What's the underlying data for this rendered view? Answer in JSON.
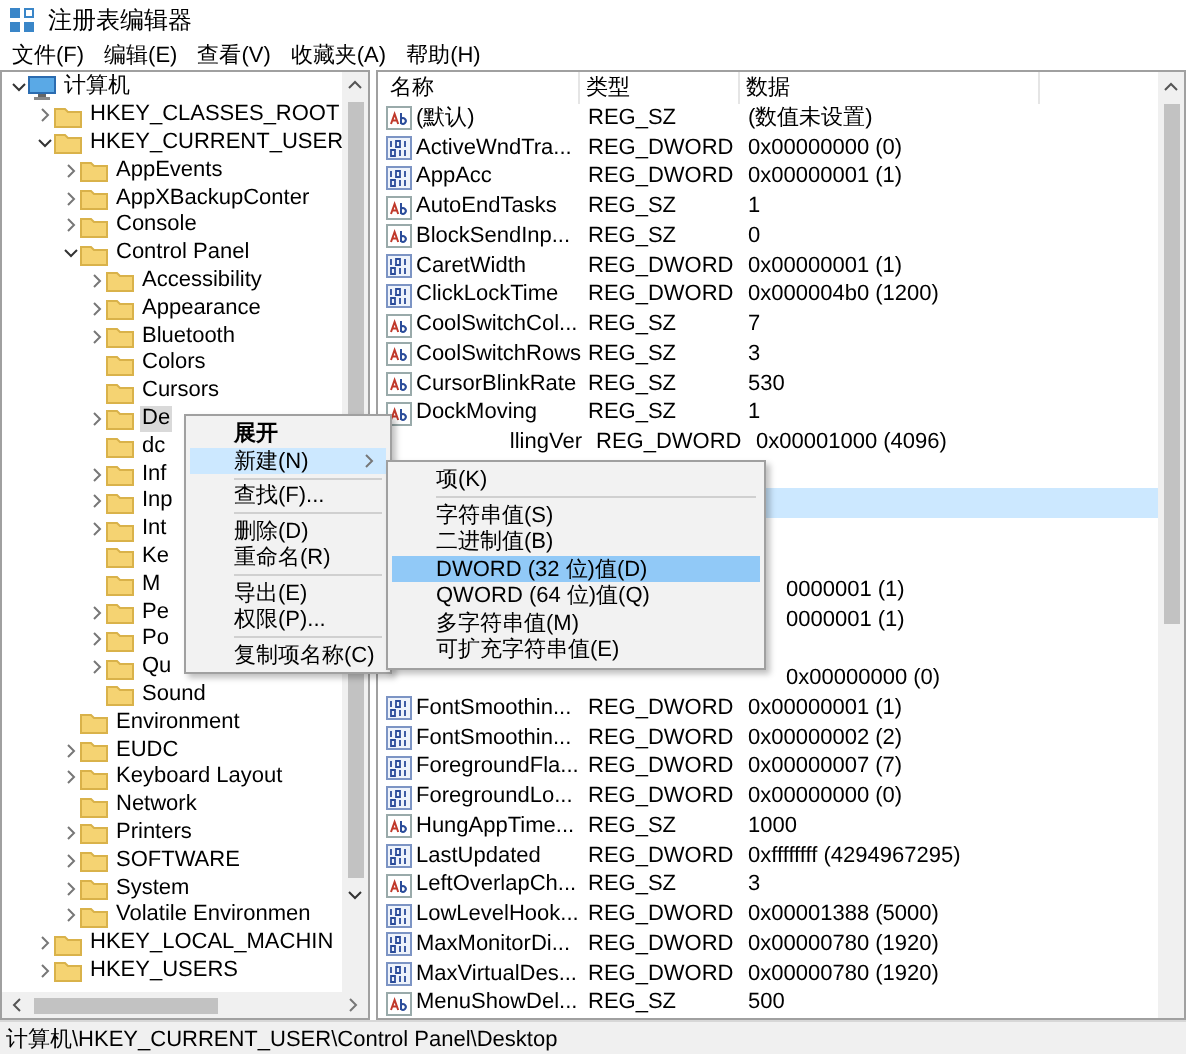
{
  "window": {
    "title": "注册表编辑器"
  },
  "menu_bar": [
    "文件(F)",
    "编辑(E)",
    "查看(V)",
    "收藏夹(A)",
    "帮助(H)"
  ],
  "tree": [
    {
      "label": "计算机",
      "kind": "computer",
      "expanded": true,
      "selected": false,
      "children": [
        {
          "label": "HKEY_CLASSES_ROOT",
          "kind": "folder",
          "expanded": false,
          "selected": false
        },
        {
          "label": "HKEY_CURRENT_USER",
          "kind": "folder",
          "expanded": true,
          "selected": false,
          "children": [
            {
              "label": "AppEvents",
              "kind": "folder",
              "expanded": false,
              "selected": false
            },
            {
              "label": "AppXBackupConter",
              "kind": "folder",
              "expanded": false,
              "selected": false
            },
            {
              "label": "Console",
              "kind": "folder",
              "expanded": false,
              "selected": false
            },
            {
              "label": "Control Panel",
              "kind": "folder",
              "expanded": true,
              "selected": false,
              "children": [
                {
                  "label": "Accessibility",
                  "kind": "folder",
                  "expanded": false,
                  "selected": false
                },
                {
                  "label": "Appearance",
                  "kind": "folder",
                  "expanded": false,
                  "selected": false
                },
                {
                  "label": "Bluetooth",
                  "kind": "folder",
                  "expanded": false,
                  "selected": false
                },
                {
                  "label": "Colors",
                  "kind": "folder",
                  "selected": false
                },
                {
                  "label": "Cursors",
                  "kind": "folder",
                  "selected": false
                },
                {
                  "label": "De",
                  "kind": "folder",
                  "expanded": false,
                  "selected": true
                },
                {
                  "label": "dc",
                  "kind": "folder",
                  "selected": false
                },
                {
                  "label": "Inf",
                  "kind": "folder",
                  "expanded": false,
                  "selected": false
                },
                {
                  "label": "Inp",
                  "kind": "folder",
                  "expanded": false,
                  "selected": false
                },
                {
                  "label": "Int",
                  "kind": "folder",
                  "expanded": false,
                  "selected": false
                },
                {
                  "label": "Ke",
                  "kind": "folder",
                  "selected": false
                },
                {
                  "label": "M",
                  "kind": "folder",
                  "selected": false
                },
                {
                  "label": "Pe",
                  "kind": "folder",
                  "expanded": false,
                  "selected": false
                },
                {
                  "label": "Po",
                  "kind": "folder",
                  "expanded": false,
                  "selected": false
                },
                {
                  "label": "Qu",
                  "kind": "folder",
                  "expanded": false,
                  "selected": false
                },
                {
                  "label": "Sound",
                  "kind": "folder",
                  "selected": false
                }
              ]
            },
            {
              "label": "Environment",
              "kind": "folder",
              "selected": false
            },
            {
              "label": "EUDC",
              "kind": "folder",
              "expanded": false,
              "selected": false
            },
            {
              "label": "Keyboard Layout",
              "kind": "folder",
              "expanded": false,
              "selected": false
            },
            {
              "label": "Network",
              "kind": "folder",
              "selected": false
            },
            {
              "label": "Printers",
              "kind": "folder",
              "expanded": false,
              "selected": false
            },
            {
              "label": "SOFTWARE",
              "kind": "folder",
              "expanded": false,
              "selected": false
            },
            {
              "label": "System",
              "kind": "folder",
              "expanded": false,
              "selected": false
            },
            {
              "label": "Volatile Environmen",
              "kind": "folder",
              "expanded": false,
              "selected": false
            }
          ]
        },
        {
          "label": "HKEY_LOCAL_MACHIN",
          "kind": "folder",
          "expanded": false,
          "selected": false
        },
        {
          "label": "HKEY_USERS",
          "kind": "folder",
          "expanded": false,
          "selected": false
        }
      ]
    }
  ],
  "list": {
    "columns": [
      "名称",
      "类型",
      "数据"
    ],
    "rows": [
      {
        "kind": "string",
        "name": "(默认)",
        "type": "REG_SZ",
        "data": "(数值未设置)",
        "selected": false
      },
      {
        "kind": "dword",
        "name": "ActiveWndTra...",
        "type": "REG_DWORD",
        "data": "0x00000000 (0)",
        "selected": false
      },
      {
        "kind": "dword",
        "name": "AppAcc",
        "type": "REG_DWORD",
        "data": "0x00000001 (1)",
        "selected": false
      },
      {
        "kind": "string",
        "name": "AutoEndTasks",
        "type": "REG_SZ",
        "data": "1",
        "selected": false
      },
      {
        "kind": "string",
        "name": "BlockSendInp...",
        "type": "REG_SZ",
        "data": "0",
        "selected": false
      },
      {
        "kind": "dword",
        "name": "CaretWidth",
        "type": "REG_DWORD",
        "data": "0x00000001 (1)",
        "selected": false
      },
      {
        "kind": "dword",
        "name": "ClickLockTime",
        "type": "REG_DWORD",
        "data": "0x000004b0 (1200)",
        "selected": false
      },
      {
        "kind": "string",
        "name": "CoolSwitchCol...",
        "type": "REG_SZ",
        "data": "7",
        "selected": false
      },
      {
        "kind": "string",
        "name": "CoolSwitchRows",
        "type": "REG_SZ",
        "data": "3",
        "selected": false
      },
      {
        "kind": "string",
        "name": "CursorBlinkRate",
        "type": "REG_SZ",
        "data": "530",
        "selected": false
      },
      {
        "kind": "string",
        "name": "DockMoving",
        "type": "REG_SZ",
        "data": "1",
        "selected": false
      },
      {
        "kind": "covered",
        "name": "llingVer",
        "type": "REG_DWORD",
        "data": "0x00001000 (4096)",
        "selected": false
      },
      {
        "kind": "covered",
        "selected": false
      },
      {
        "kind": "covered",
        "selected": true
      },
      {
        "kind": "covered",
        "selected": false
      },
      {
        "kind": "covered",
        "selected": false
      },
      {
        "kind": "covered",
        "data": "0000001 (1)",
        "selected": false
      },
      {
        "kind": "covered",
        "data": "0000001 (1)",
        "selected": false
      },
      {
        "kind": "covered",
        "selected": false
      },
      {
        "kind": "covered",
        "data": "0x00000000 (0)",
        "selected": false
      },
      {
        "kind": "dword",
        "name": "FontSmoothin...",
        "type": "REG_DWORD",
        "data": "0x00000001 (1)",
        "selected": false
      },
      {
        "kind": "dword",
        "name": "FontSmoothin...",
        "type": "REG_DWORD",
        "data": "0x00000002 (2)",
        "selected": false
      },
      {
        "kind": "dword",
        "name": "ForegroundFla...",
        "type": "REG_DWORD",
        "data": "0x00000007 (7)",
        "selected": false
      },
      {
        "kind": "dword",
        "name": "ForegroundLo...",
        "type": "REG_DWORD",
        "data": "0x00000000 (0)",
        "selected": false
      },
      {
        "kind": "string",
        "name": "HungAppTime...",
        "type": "REG_SZ",
        "data": "1000",
        "selected": false
      },
      {
        "kind": "dword",
        "name": "LastUpdated",
        "type": "REG_DWORD",
        "data": "0xffffffff (4294967295)",
        "selected": false
      },
      {
        "kind": "string",
        "name": "LeftOverlapCh...",
        "type": "REG_SZ",
        "data": "3",
        "selected": false
      },
      {
        "kind": "dword",
        "name": "LowLevelHook...",
        "type": "REG_DWORD",
        "data": "0x00001388 (5000)",
        "selected": false
      },
      {
        "kind": "dword",
        "name": "MaxMonitorDi...",
        "type": "REG_DWORD",
        "data": "0x00000780 (1920)",
        "selected": false
      },
      {
        "kind": "dword",
        "name": "MaxVirtualDes...",
        "type": "REG_DWORD",
        "data": "0x00000780 (1920)",
        "selected": false
      },
      {
        "kind": "string",
        "name": "MenuShowDel...",
        "type": "REG_SZ",
        "data": "500",
        "selected": false
      }
    ]
  },
  "context_menu": {
    "items": [
      {
        "kind": "item",
        "label": "展开",
        "default": true,
        "submenu": false,
        "selected": false
      },
      {
        "kind": "item",
        "label": "新建(N)",
        "default": false,
        "submenu": true,
        "selected": true
      },
      {
        "kind": "separator"
      },
      {
        "kind": "item",
        "label": "查找(F)...",
        "default": false,
        "submenu": false,
        "selected": false
      },
      {
        "kind": "separator"
      },
      {
        "kind": "item",
        "label": "删除(D)",
        "default": false,
        "submenu": false,
        "selected": false
      },
      {
        "kind": "item",
        "label": "重命名(R)",
        "default": false,
        "submenu": false,
        "selected": false
      },
      {
        "kind": "separator"
      },
      {
        "kind": "item",
        "label": "导出(E)",
        "default": false,
        "submenu": false,
        "selected": false
      },
      {
        "kind": "item",
        "label": "权限(P)...",
        "default": false,
        "submenu": false,
        "selected": false
      },
      {
        "kind": "separator"
      },
      {
        "kind": "item",
        "label": "复制项名称(C)",
        "default": false,
        "submenu": false,
        "selected": false
      }
    ]
  },
  "submenu": {
    "items": [
      {
        "kind": "item",
        "label": "项(K)",
        "default": false,
        "submenu": false,
        "selected": false
      },
      {
        "kind": "separator"
      },
      {
        "kind": "item",
        "label": "字符串值(S)",
        "default": false,
        "submenu": false,
        "selected": false
      },
      {
        "kind": "item",
        "label": "二进制值(B)",
        "default": false,
        "submenu": false,
        "selected": false
      },
      {
        "kind": "item",
        "label": "DWORD (32 位)值(D)",
        "default": false,
        "submenu": false,
        "selected": true
      },
      {
        "kind": "item",
        "label": "QWORD (64 位)值(Q)",
        "default": false,
        "submenu": false,
        "selected": false
      },
      {
        "kind": "item",
        "label": "多字符串值(M)",
        "default": false,
        "submenu": false,
        "selected": false
      },
      {
        "kind": "item",
        "label": "可扩充字符串值(E)",
        "default": false,
        "submenu": false,
        "selected": false
      }
    ]
  },
  "status_bar": "计算机\\HKEY_CURRENT_USER\\Control Panel\\Desktop"
}
